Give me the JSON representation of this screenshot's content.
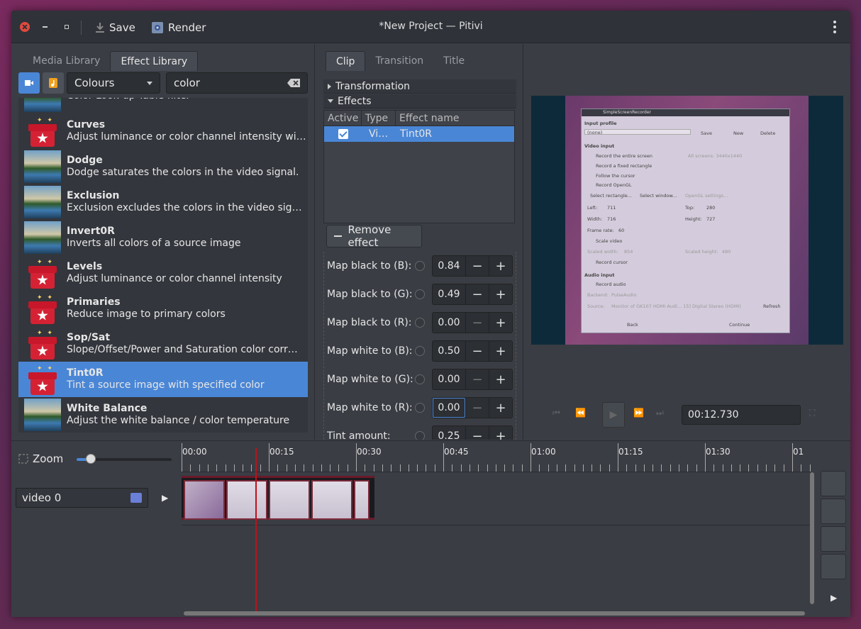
{
  "window": {
    "title": "*New Project — Pitivi",
    "save_label": "Save",
    "render_label": "Render"
  },
  "library": {
    "tabs": [
      "Media Library",
      "Effect Library"
    ],
    "category": "Colours",
    "search_value": "color",
    "effects": [
      {
        "name": "",
        "desc": "Color Look-up Table filter",
        "icon": "landscape-thumbnail"
      },
      {
        "name": "Curves",
        "desc": "Adjust luminance or color channel intensity wi…",
        "icon": "gift-box-icon"
      },
      {
        "name": "Dodge",
        "desc": "Dodge saturates the colors in the video signal.",
        "icon": "landscape-thumbnail"
      },
      {
        "name": "Exclusion",
        "desc": "Exclusion excludes the colors in the video signal.",
        "icon": "landscape-thumbnail"
      },
      {
        "name": "Invert0R",
        "desc": "Inverts all colors of a source image",
        "icon": "landscape-thumbnail"
      },
      {
        "name": "Levels",
        "desc": "Adjust luminance or color channel intensity",
        "icon": "gift-box-icon"
      },
      {
        "name": "Primaries",
        "desc": "Reduce image to primary colors",
        "icon": "gift-box-icon"
      },
      {
        "name": "Sop/Sat",
        "desc": "Slope/Offset/Power and Saturation color corr…",
        "icon": "gift-box-icon"
      },
      {
        "name": "Tint0R",
        "desc": "Tint a source image with specified color",
        "icon": "gift-box-icon"
      },
      {
        "name": "White Balance",
        "desc": "Adjust the white balance / color temperature",
        "icon": "landscape-thumbnail"
      }
    ],
    "selected": "Tint0R"
  },
  "clip": {
    "tabs": [
      "Clip",
      "Transition",
      "Title"
    ],
    "transformation_label": "Transformation",
    "effects_label": "Effects",
    "table_headers": [
      "Active",
      "Type",
      "Effect name"
    ],
    "row": {
      "type": "Vi…",
      "name": "Tint0R"
    },
    "remove_label": "Remove effect",
    "params": [
      {
        "label": "Map black to (B):",
        "value": "0.84"
      },
      {
        "label": "Map black to (G):",
        "value": "0.49"
      },
      {
        "label": "Map black to (R):",
        "value": "0.00"
      },
      {
        "label": "Map white to (B):",
        "value": "0.50"
      },
      {
        "label": "Map white to (G):",
        "value": "0.00"
      },
      {
        "label": "Map white to (R):",
        "value": "0.00"
      },
      {
        "label": "Tint amount:",
        "value": "0.25"
      }
    ]
  },
  "viewer": {
    "timecode": "00:12.730",
    "preview": {
      "app_title": "SimpleScreenRecorder",
      "input_profile": "Input profile",
      "profile_value": "(none)",
      "buttons": [
        "Save",
        "New",
        "Delete"
      ],
      "video_input": "Video input",
      "options": [
        "Record the entire screen",
        "Record a fixed rectangle",
        "Follow the cursor",
        "Record OpenGL"
      ],
      "all_screens": "All screens: 3440x1440",
      "select_buttons": [
        "Select rectangle...",
        "Select window...",
        "OpenGL settings..."
      ],
      "left_label": "Left:",
      "left_value": "711",
      "top_label": "Top:",
      "top_value": "280",
      "width_label": "Width:",
      "width_value": "716",
      "height_label": "Height:",
      "height_value": "727",
      "framerate_label": "Frame rate:",
      "framerate_value": "60",
      "scale_video": "Scale video",
      "scaled_width": "Scaled width:",
      "scaled_width_value": "854",
      "scaled_height": "Scaled height:",
      "scaled_height_value": "480",
      "record_cursor": "Record cursor",
      "audio_input": "Audio input",
      "record_audio": "Record audio",
      "backend": "Backend:",
      "backend_value": "PulseAudio",
      "source": "Source:",
      "source_value": "Monitor of GK107 HDMI Audi... 15] Digital Stereo (HDMI)",
      "refresh": "Refresh",
      "back": "Back",
      "continue": "Continue"
    }
  },
  "timeline": {
    "zoom_label": "Zoom",
    "zoom_level": 0.15,
    "ruler": [
      "00:00",
      "00:15",
      "00:30",
      "00:45",
      "01:00",
      "01:15",
      "01:30",
      "01"
    ],
    "layer_name": "video 0"
  }
}
